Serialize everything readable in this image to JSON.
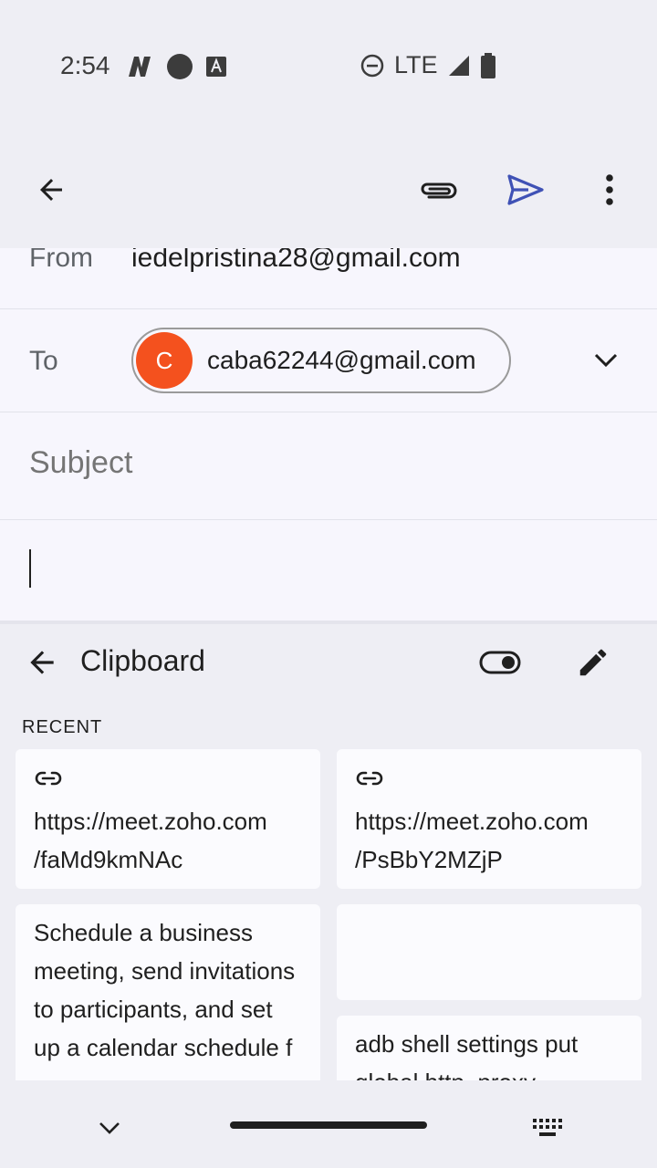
{
  "status_bar": {
    "time": "2:54",
    "network": "LTE",
    "icons_left": [
      "notification-n-icon",
      "circle-icon",
      "text-a-icon"
    ],
    "icons_right": [
      "do-not-disturb-icon",
      "signal-icon",
      "battery-icon"
    ]
  },
  "toolbar": {
    "back_icon": "back-arrow-icon",
    "attach_icon": "paperclip-icon",
    "send_icon": "send-icon",
    "more_icon": "more-vert-icon",
    "send_color": "#3f51b5"
  },
  "compose": {
    "from_label": "From",
    "from_value": "iedelpristina28@gmail.com",
    "to_label": "To",
    "to_chip": {
      "avatar_letter": "C",
      "avatar_color": "#f4511e",
      "email": "caba62244@gmail.com"
    },
    "subject_placeholder": "Subject",
    "body_value": ""
  },
  "clipboard": {
    "title": "Clipboard",
    "section_label": "RECENT",
    "items": [
      {
        "type": "link",
        "text": "https://meet.zoho.com\n/faMd9kmNAc"
      },
      {
        "type": "link",
        "text": "https://meet.zoho.com\n/PsBbY2MZjP"
      },
      {
        "type": "text",
        "text": "Schedule a business meeting, send invitations to participants, and set up a calendar schedule f"
      },
      {
        "type": "empty",
        "text": ""
      },
      {
        "type": "text",
        "text": "adb shell settings put global http_proxy"
      }
    ]
  }
}
